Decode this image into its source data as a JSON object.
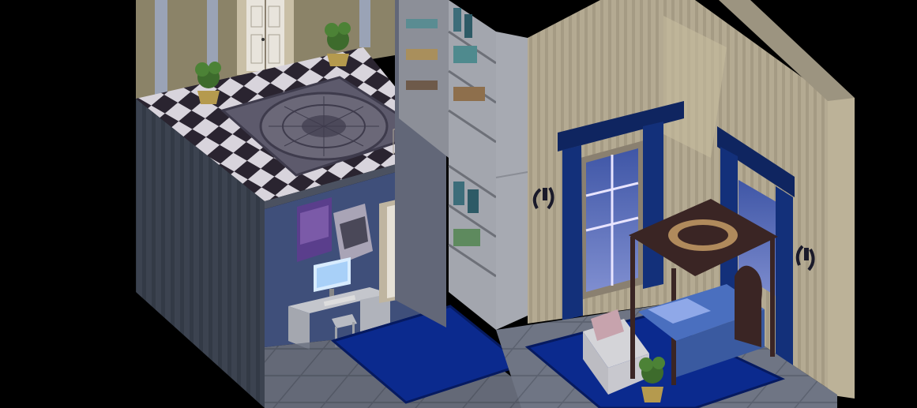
{
  "scene": {
    "type": "isometric-diorama",
    "rooms": [
      "upper-hall",
      "study",
      "library",
      "bedroom"
    ],
    "palette": {
      "background": "#000000",
      "wall_blue": "#3f4f7a",
      "wall_cream": "#b9ae95",
      "floor_tile": "#6c7280",
      "rug_blue": "#0b2a8e",
      "curtain_navy": "#11265a",
      "wood_dark": "#3a2524"
    },
    "objects": [
      "checker-floor",
      "medallion-rug",
      "potted-plant",
      "double-door",
      "poster",
      "computer-monitor",
      "desk",
      "chair",
      "dress-mannequin",
      "white-door",
      "bookshelf",
      "window",
      "curtain",
      "wall-sconce",
      "canopy-bed",
      "armchair",
      "blue-rug"
    ]
  }
}
